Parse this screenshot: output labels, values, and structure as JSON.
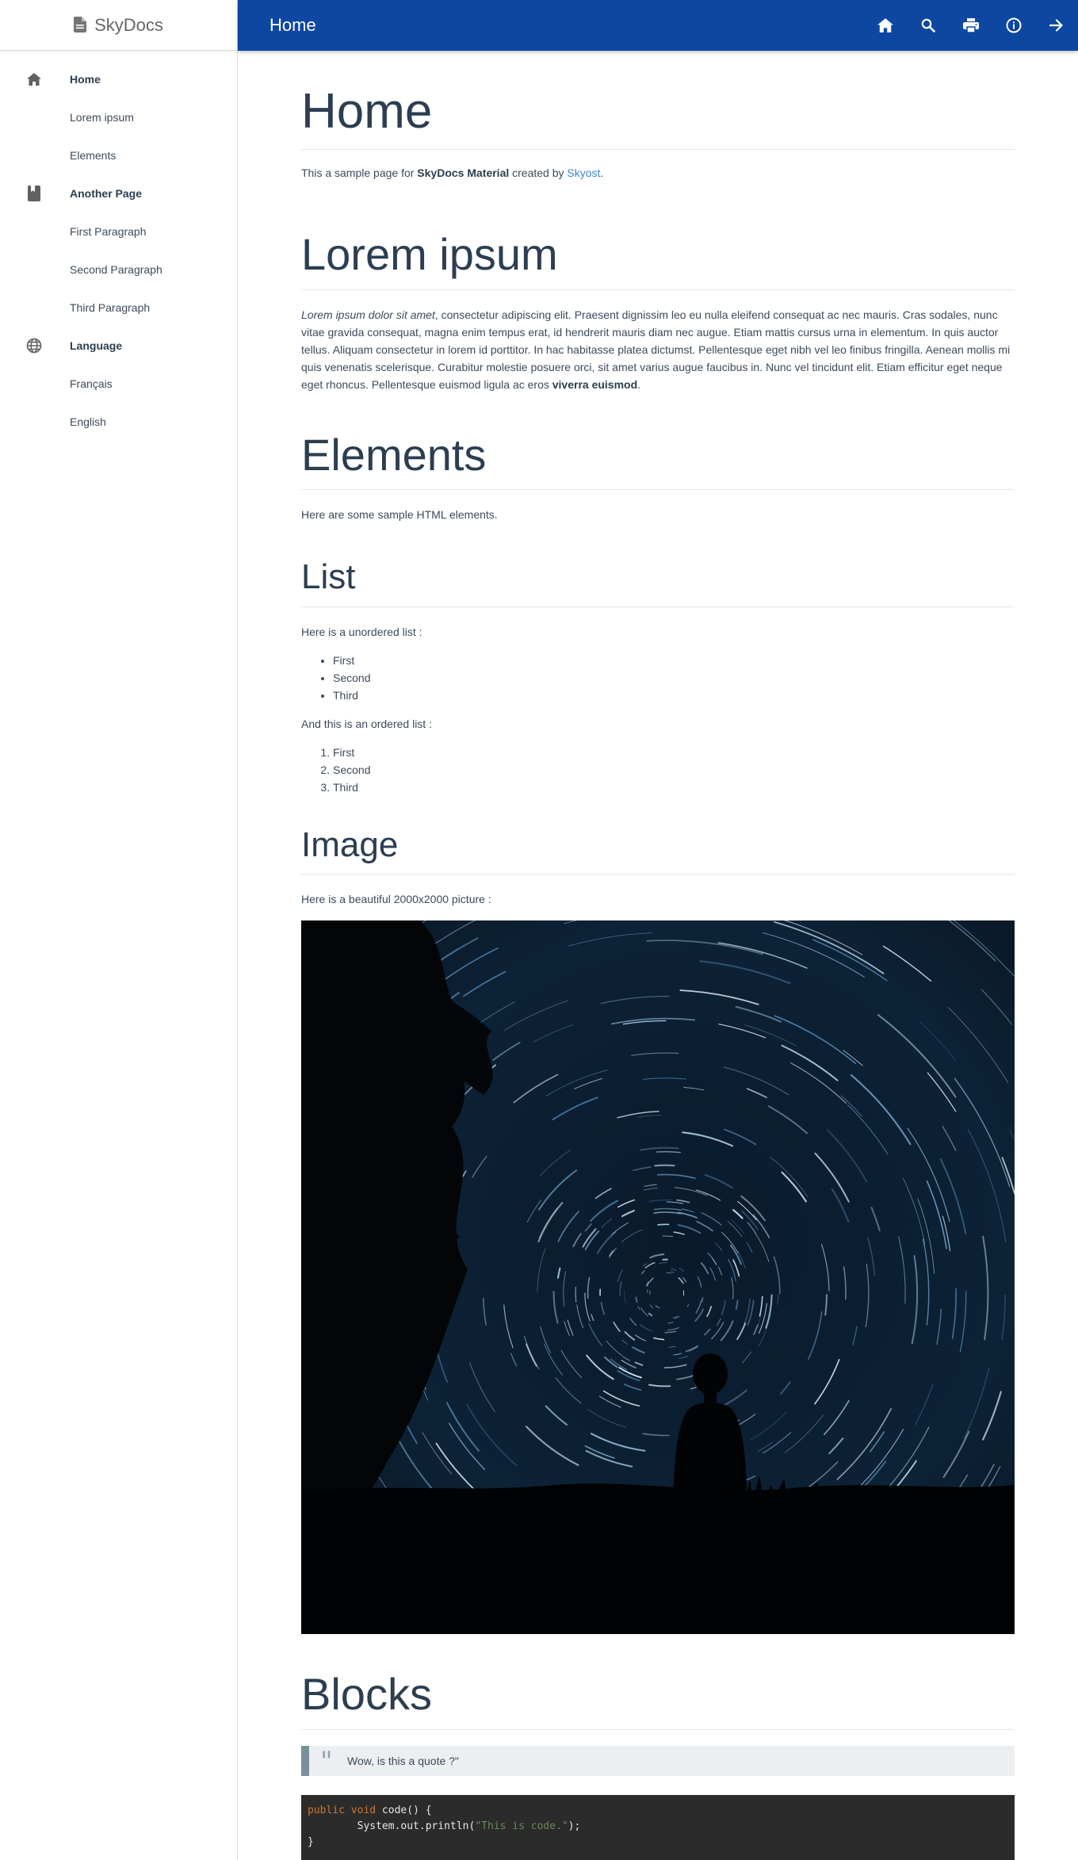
{
  "sidebar": {
    "brand": "SkyDocs",
    "items": [
      {
        "label": "Home",
        "icon": "home-icon",
        "level": "top"
      },
      {
        "label": "Lorem ipsum",
        "level": "sub"
      },
      {
        "label": "Elements",
        "level": "sub"
      },
      {
        "label": "Another Page",
        "icon": "book-icon",
        "level": "top"
      },
      {
        "label": "First Paragraph",
        "level": "sub"
      },
      {
        "label": "Second Paragraph",
        "level": "sub"
      },
      {
        "label": "Third Paragraph",
        "level": "sub"
      },
      {
        "label": "Language",
        "icon": "globe-icon",
        "level": "top"
      },
      {
        "label": "Français",
        "level": "sub"
      },
      {
        "label": "English",
        "level": "sub"
      }
    ]
  },
  "topbar": {
    "title": "Home",
    "actions": [
      "home-icon",
      "search-icon",
      "print-icon",
      "info-icon",
      "arrow-right-icon"
    ],
    "color": "#0d47a1"
  },
  "content": {
    "title": "Home",
    "intro": {
      "prefix": "This a sample page for ",
      "strong": "SkyDocs Material",
      "middle": " created by ",
      "link": "Skyost",
      "suffix": "."
    },
    "lorem": {
      "heading": "Lorem ipsum",
      "italic": "Lorem ipsum dolor sit amet",
      "body": ", consectetur adipiscing elit. Praesent dignissim leo eu nulla eleifend consequat ac nec mauris. Cras sodales, nunc vitae gravida consequat, magna enim tempus erat, id hendrerit mauris diam nec augue. Etiam mattis cursus urna in elementum. In quis auctor tellus. Aliquam consectetur in lorem id porttitor. In hac habitasse platea dictumst. Pellentesque eget nibh vel leo finibus fringilla. Aenean mollis mi quis venenatis scelerisque. Curabitur molestie posuere orci, sit amet varius augue faucibus in. Nunc vel tincidunt elit. Etiam efficitur eget neque eget rhoncus. Pellentesque euismod ligula ac eros ",
      "strong": "viverra euismod",
      "end": "."
    },
    "elements": {
      "heading": "Elements",
      "text": "Here are some sample HTML elements."
    },
    "list": {
      "heading": "List",
      "unordered_intro": "Here is a unordered list :",
      "unordered": [
        "First",
        "Second",
        "Third"
      ],
      "ordered_intro": "And this is an ordered list :",
      "ordered": [
        "First",
        "Second",
        "Third"
      ]
    },
    "image": {
      "heading": "Image",
      "text": "Here is a beautiful 2000x2000 picture :"
    },
    "blocks": {
      "heading": "Blocks",
      "quote": "Wow, is this a quote ?\"",
      "code": {
        "kw1": "public",
        "kw2": "void",
        "sig": " code() {",
        "line2_pre": "        System.out.println(",
        "line2_str": "\"This is code.\"",
        "line2_post": ");",
        "line3": "}"
      }
    }
  }
}
